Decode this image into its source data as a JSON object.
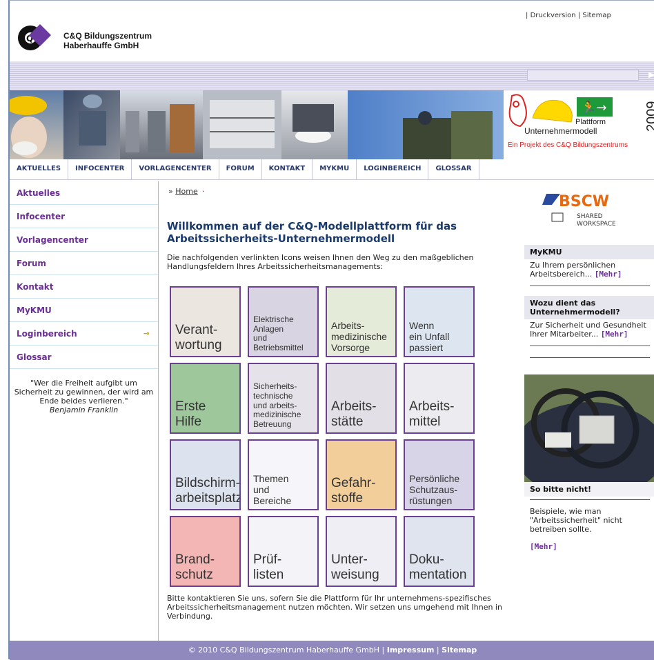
{
  "header": {
    "brand_line1": "C&Q Bildungszentrum",
    "brand_line2": "Haberhauffe GmbH",
    "druckversion": "Druckversion",
    "sitemap": "Sitemap"
  },
  "banner": {
    "plattform": "Plattform",
    "unternehmermodell": "Unternehmermodell",
    "projekt": "Ein Projekt des C&Q Bildungszentrums",
    "year": "2009"
  },
  "nav": [
    "AKTUELLES",
    "INFOCENTER",
    "VORLAGENCENTER",
    "FORUM",
    "KONTAKT",
    "MYKMU",
    "LOGINBEREICH",
    "GLOSSAR"
  ],
  "sidebar": {
    "items": [
      "Aktuelles",
      "Infocenter",
      "Vorlagencenter",
      "Forum",
      "Kontakt",
      "MyKMU",
      "Loginbereich",
      "Glossar"
    ],
    "quote": "\"Wer die Freiheit aufgibt um Sicherheit zu gewinnen, der wird am Ende beides verlieren.\"",
    "quote_author": "Benjamin Franklin"
  },
  "main": {
    "crumb_prefix": "»",
    "crumb_home": "Home",
    "title": "Willkommen auf der C&Q-Modellplattform für das Arbeitssicherheits-Unternehmermodell",
    "intro": "Die nachfolgenden verlinkten Icons weisen Ihnen den Weg zu den maßgeblichen Handlungsfeldern Ihres Arbeitssicherheitsmanagements:",
    "tiles": [
      {
        "label": "Verant-\nwortung",
        "bg": "#ece6e0"
      },
      {
        "label": "Elektrische\nAnlagen\nund\nBetriebsmittel",
        "bg": "#d8d4e2"
      },
      {
        "label": "Arbeits-\nmedizinische\nVorsorge",
        "bg": "#e4ebd8"
      },
      {
        "label": "Wenn\nein Unfall\npassiert",
        "bg": "#dde6f0"
      },
      {
        "label": "Erste\nHilfe",
        "bg": "#9fc79c"
      },
      {
        "label": "Sicherheits-\ntechnische\nund arbeits-\nmedizinische\nBetreuung",
        "bg": "#e6e2ea"
      },
      {
        "label": "Arbeits-\nstätte",
        "bg": "#e2e0e6"
      },
      {
        "label": "Arbeits-\nmittel",
        "bg": "#ececf0"
      },
      {
        "label": "Bildschirm-\narbeitsplatz",
        "bg": "#dde3ee"
      },
      {
        "label": "Themen\nund\nBereiche",
        "bg": "#f6f6fa"
      },
      {
        "label": "Gefahr-\nstoffe",
        "bg": "#f2cf9a"
      },
      {
        "label": "Persönliche\nSchutzaus-\nrüstungen",
        "bg": "#d6d4e6"
      },
      {
        "label": "Brand-\nschutz",
        "bg": "#f3b6b4"
      },
      {
        "label": "Prüf-\nlisten",
        "bg": "#f4f4f8"
      },
      {
        "label": "Unter-\nweisung",
        "bg": "#eeeeF4"
      },
      {
        "label": "Doku-\nmentation",
        "bg": "#e0e4ee"
      }
    ],
    "contact_note": "Bitte kontaktieren Sie uns, sofern Sie die Plattform für Ihr unternehmens-spezifisches Arbeitssicherheitsmanagement nutzen möchten. Wir setzen uns umgehend mit Ihnen in Verbindung."
  },
  "right": {
    "bscw_logo": "BSCW",
    "bscw_sub1": "SHARED",
    "bscw_sub2": "WORKSPACE",
    "box1_title": "MyKMU",
    "box1_text": "Zu Ihrem persönlichen Arbeitsbereich...",
    "mehr": "[Mehr]",
    "box2_title": "Wozu dient das Unternehmermodell?",
    "box2_text": "Zur Sicherheit und Gesundheit Ihrer Mitarbeiter...",
    "photo_caption": "So bitte nicht!",
    "example_text": "Beispiele, wie man \"Arbeitssicherheit\" nicht betreiben sollte."
  },
  "footer": {
    "copyright": "© 2010 C&Q Bildungszentrum Haberhauffe GmbH",
    "impressum": "Impressum",
    "sitemap": "Sitemap"
  },
  "colors": {
    "accent_purple": "#6b2f96",
    "nav_blue": "#2a3a6a",
    "footer_bg": "#8f89bd"
  }
}
